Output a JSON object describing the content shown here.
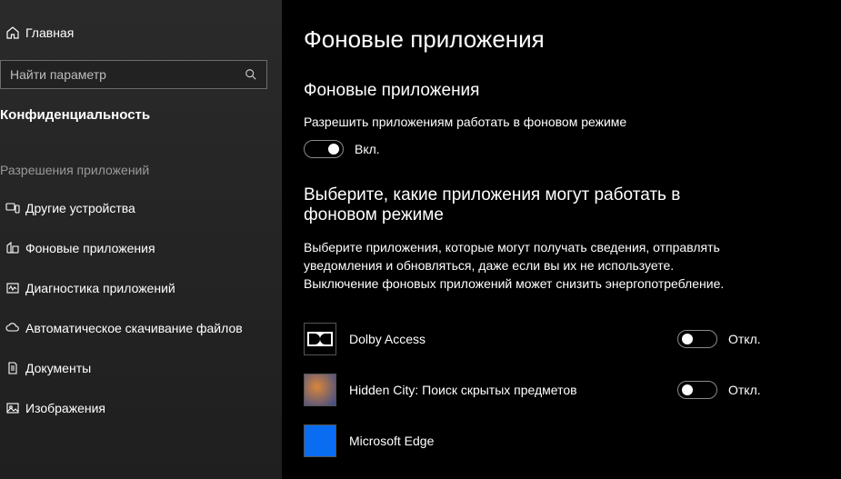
{
  "sidebar": {
    "home_label": "Главная",
    "search_placeholder": "Найти параметр",
    "category_label": "Конфиденциальность",
    "section_header": "Разрешения приложений",
    "items": [
      {
        "label": "Другие устройства"
      },
      {
        "label": "Фоновые приложения"
      },
      {
        "label": "Диагностика приложений"
      },
      {
        "label": "Автоматическое скачивание файлов"
      },
      {
        "label": "Документы"
      },
      {
        "label": "Изображения"
      }
    ]
  },
  "main": {
    "page_title": "Фоновые приложения",
    "section1_title": "Фоновые приложения",
    "allow_label": "Разрешить приложениям работать в фоновом режиме",
    "master_toggle_state": "Вкл.",
    "section2_title": "Выберите, какие приложения могут работать в фоновом режиме",
    "section2_desc": "Выберите приложения, которые могут получать сведения, отправлять уведомления и обновляться, даже если вы их не используете. Выключение фоновых приложений может снизить энергопотребление.",
    "apps": [
      {
        "name": "Dolby Access",
        "state": "Откл."
      },
      {
        "name": "Hidden City: Поиск скрытых предметов",
        "state": "Откл."
      },
      {
        "name": "Microsoft Edge",
        "state": ""
      }
    ]
  }
}
